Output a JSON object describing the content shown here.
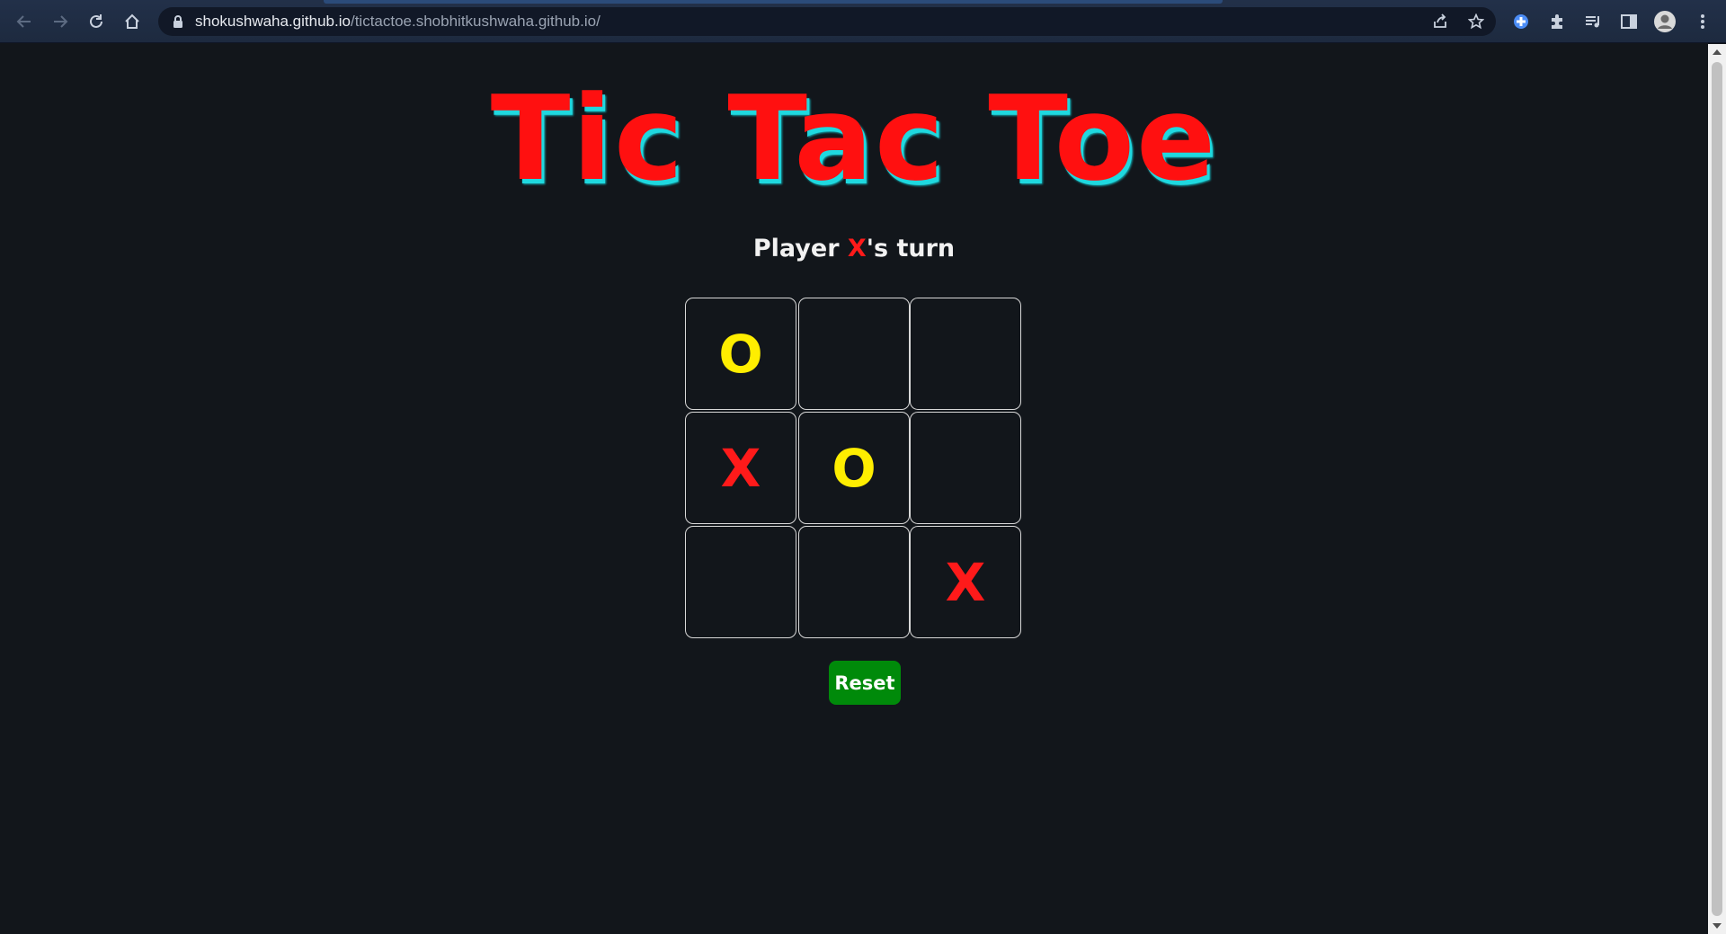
{
  "browser": {
    "url_host": "shokushwaha.github.io",
    "url_path": "/tictactoe.shobhitkushwaha.github.io/",
    "icons": [
      "back-arrow-icon",
      "forward-arrow-icon",
      "reload-icon",
      "home-icon",
      "lock-icon",
      "share-icon",
      "star-icon",
      "extension-icon",
      "puzzle-icon",
      "media-queue-icon",
      "side-panel-icon",
      "profile-avatar-icon",
      "kebab-menu-icon"
    ]
  },
  "game": {
    "title": "Tic Tac Toe",
    "status_prefix": "Player ",
    "current_player": "X",
    "status_suffix": "'s turn",
    "board": [
      "O",
      "",
      "",
      "X",
      "O",
      "",
      "",
      "",
      "X"
    ],
    "reset_label": "Reset"
  },
  "colors": {
    "background": "#12161b",
    "title": "#ff1010",
    "title_shadow": "#1fd8df",
    "x_mark": "#ff1a1a",
    "o_mark": "#ffee00",
    "reset_button": "#008a0a",
    "cell_border": "#d8d8d8"
  }
}
